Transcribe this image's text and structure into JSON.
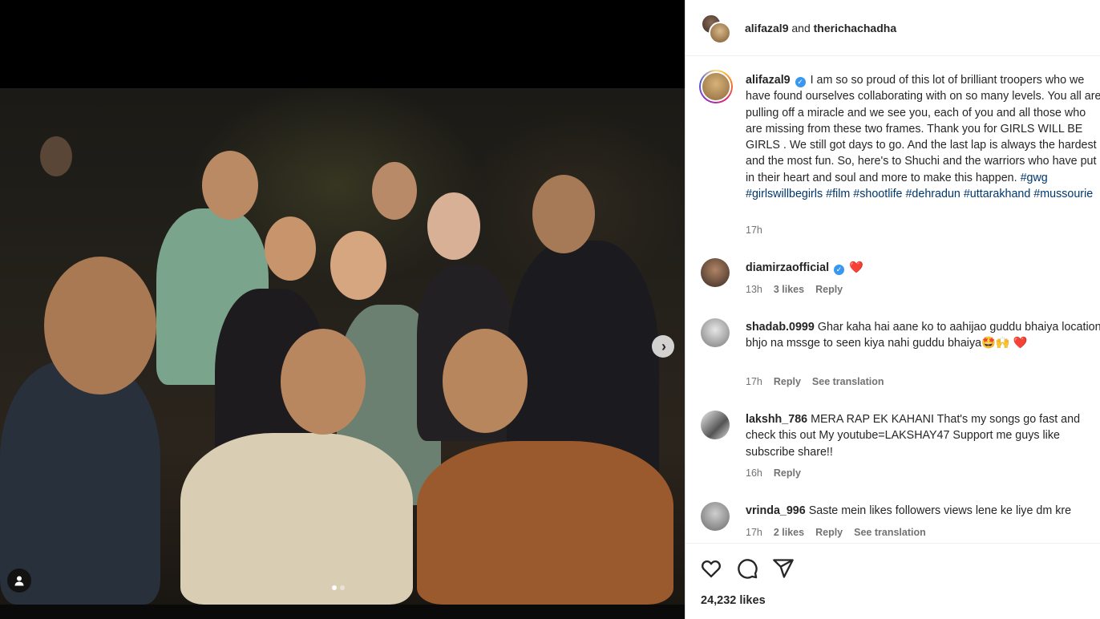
{
  "header": {
    "user1": "alifazal9",
    "joiner": "and",
    "user2": "therichachadha"
  },
  "caption": {
    "username": "alifazal9",
    "text": "I am so so proud of this lot of brilliant troopers who we have found ourselves collaborating with on so many levels. You all are pulling off a miracle and we see you, each of you and all those who are missing from these two frames. Thank you for GIRLS WILL BE GIRLS . We still got days to go. And the last lap is always the hardest and the most fun. So, here's to Shuchi and the warriors who have put in their heart and soul and more to make this happen.",
    "hashtags": [
      "#gwg",
      "#girlswillbegirls",
      "#film",
      "#shootlife",
      "#dehradun",
      "#uttarakhand",
      "#mussourie"
    ],
    "time": "17h"
  },
  "comments": [
    {
      "username": "diamirzaofficial",
      "verified": true,
      "text": "❤️",
      "time": "13h",
      "likes": "3 likes",
      "reply": "Reply",
      "translate": ""
    },
    {
      "username": "shadab.0999",
      "verified": false,
      "text": "Ghar kaha hai aane ko to aahijao guddu bhaiya location bhjo na mssge to seen kiya nahi guddu bhaiya🤩🙌 ❤️",
      "time": "17h",
      "likes": "",
      "reply": "Reply",
      "translate": "See translation"
    },
    {
      "username": "lakshh_786",
      "verified": false,
      "text": "MERA RAP EK KAHANI That's my songs go fast and check this out My youtube=LAKSHAY47 Support me guys like subscribe share!!",
      "time": "16h",
      "likes": "",
      "reply": "Reply",
      "translate": ""
    },
    {
      "username": "vrinda_996",
      "verified": false,
      "text": "Saste mein likes followers views lene ke liye dm kre",
      "time": "17h",
      "likes": "2 likes",
      "reply": "Reply",
      "translate": "See translation"
    }
  ],
  "actions": {
    "likes": "24,232 likes"
  },
  "icons": {
    "like": "heart-icon",
    "comment": "comment-icon",
    "share": "share-icon",
    "next": "chevron-right-icon",
    "tags": "user-tag-icon"
  },
  "colors": {
    "link": "#00376b",
    "verified": "#3897f0",
    "muted": "#737373"
  },
  "media": {
    "slides": 2,
    "current_slide": 1
  }
}
